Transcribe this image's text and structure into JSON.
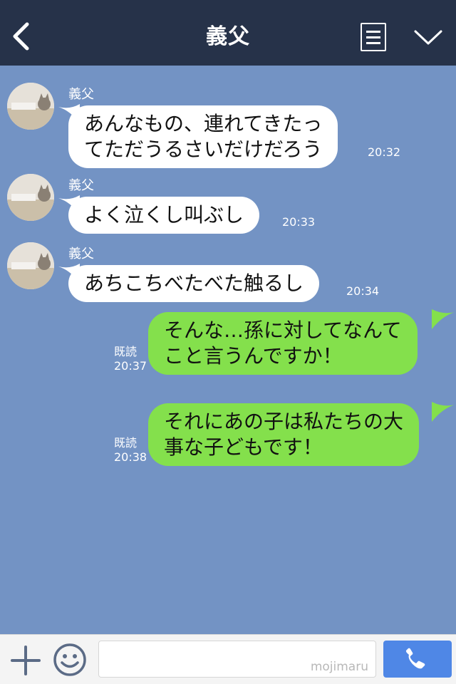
{
  "header": {
    "title": "義父",
    "back_icon": "chevron-left-icon",
    "menu_icon": "note-icon",
    "expand_icon": "chevron-down-icon"
  },
  "messages": [
    {
      "direction": "in",
      "sender": "義父",
      "text": "あんなもの、連れてきたっ\nてただうるさいだけだろう",
      "time": "20:32"
    },
    {
      "direction": "in",
      "sender": "義父",
      "text": "よく泣くし叫ぶし",
      "time": "20:33"
    },
    {
      "direction": "in",
      "sender": "義父",
      "text": "あちこちべたべた触るし",
      "time": "20:34"
    },
    {
      "direction": "out",
      "read": "既読",
      "text": "そんな…孫に対してなんて\nこと言うんですか！",
      "time": "20:37"
    },
    {
      "direction": "out",
      "read": "既読",
      "text": "それにあの子は私たちの大\n事な子どもです！",
      "time": "20:38"
    }
  ],
  "footer": {
    "plus_icon": "plus-icon",
    "emoji_icon": "smiley-icon",
    "input_value": "",
    "watermark": "mojimaru",
    "call_icon": "phone-icon"
  },
  "colors": {
    "header_bg": "#263249",
    "chat_bg": "#7393c4",
    "incoming_bubble": "#ffffff",
    "outgoing_bubble": "#84e04c",
    "call_button": "#4f87e6"
  }
}
